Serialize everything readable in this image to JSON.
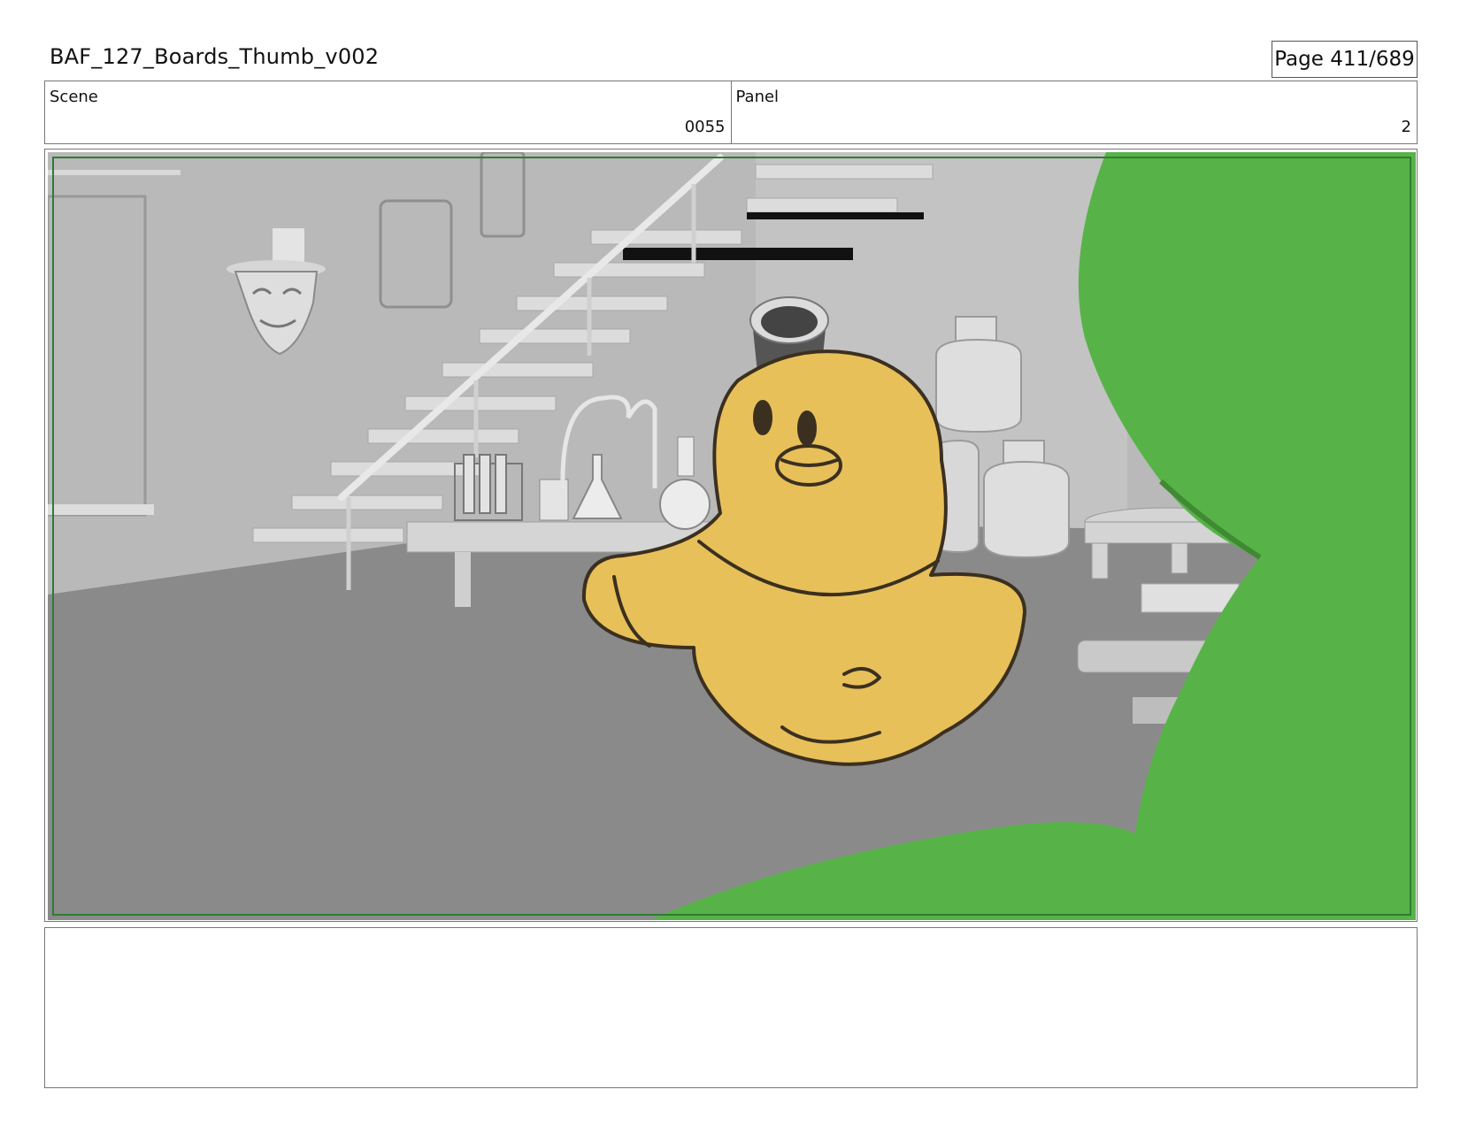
{
  "document": {
    "title": "BAF_127_Boards_Thumb_v002",
    "page_label": "Page 411/689"
  },
  "info": {
    "scene_label": "Scene",
    "scene_value": "0055",
    "panel_label": "Panel",
    "panel_value": "2"
  },
  "panel_image": {
    "frame_color": "#2e7d32",
    "character_color": "#e8c05a",
    "foreground_color": "#57b347"
  },
  "notes": {
    "text": ""
  }
}
